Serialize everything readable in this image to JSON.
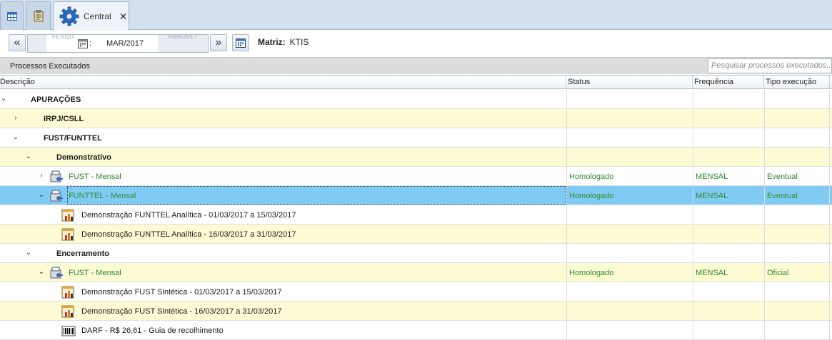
{
  "tabs": [
    {
      "name": "grid-tab",
      "label": ""
    },
    {
      "name": "clipboard-tab",
      "label": ""
    },
    {
      "name": "central-tab",
      "label": "Central",
      "close": "✕"
    }
  ],
  "toolbar": {
    "prev": "«",
    "next": "»",
    "period_prev": "FEV/20",
    "period_current": "MAR/2017",
    "period_next": "ABR/2017",
    "colon": ":",
    "matriz_label": "Matriz:",
    "matriz_value": "KTIS"
  },
  "panel": {
    "title": "Processos Executados",
    "search_placeholder": "Pesquisar processos executados..."
  },
  "columns": {
    "descricao": "Descrição",
    "status": "Status",
    "frequencia": "Frequência",
    "tipo": "Tipo execução"
  },
  "rows": [
    {
      "label": "APURAÇÕES",
      "status": "",
      "freq": "",
      "tipo": ""
    },
    {
      "label": "IRPJ/CSLL",
      "status": "",
      "freq": "",
      "tipo": ""
    },
    {
      "label": "FUST/FUNTTEL",
      "status": "",
      "freq": "",
      "tipo": ""
    },
    {
      "label": "Demonstrativo",
      "status": "",
      "freq": "",
      "tipo": ""
    },
    {
      "label": "FUST - Mensal",
      "status": "Homologado",
      "freq": "MENSAL",
      "tipo": "Eventual"
    },
    {
      "label": "FUNTTEL - Mensal",
      "status": "Homologado",
      "freq": "MENSAL",
      "tipo": "Eventual"
    },
    {
      "label": "Demonstração FUNTTEL Analítica - 01/03/2017 a 15/03/2017",
      "status": "",
      "freq": "",
      "tipo": ""
    },
    {
      "label": "Demonstração FUNTTEL Analítica - 16/03/2017 a 31/03/2017",
      "status": "",
      "freq": "",
      "tipo": ""
    },
    {
      "label": "Encerramento",
      "status": "",
      "freq": "",
      "tipo": ""
    },
    {
      "label": "FUST - Mensal",
      "status": "Homologado",
      "freq": "MENSAL",
      "tipo": "Oficial"
    },
    {
      "label": "Demonstração FUST Sintética - 01/03/2017 a 15/03/2017",
      "status": "",
      "freq": "",
      "tipo": ""
    },
    {
      "label": "Demonstração FUST Sintética - 16/03/2017 a 31/03/2017",
      "status": "",
      "freq": "",
      "tipo": ""
    },
    {
      "label": "DARF - R$ 26,61 - Guia de recolhimento",
      "status": "",
      "freq": "",
      "tipo": ""
    }
  ],
  "colors": {
    "selected_row": "#80cbf4",
    "alt_row": "#fdfbd4",
    "status_text": "#2d8a2d"
  }
}
